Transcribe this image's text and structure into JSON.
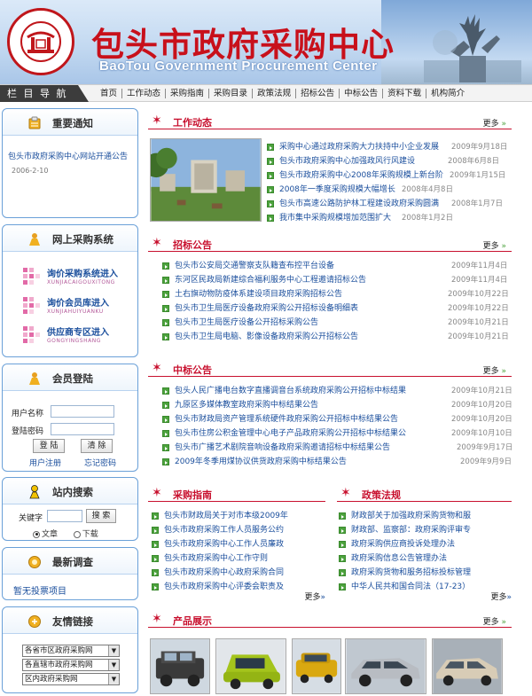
{
  "header": {
    "title": "包头市政府采购中心",
    "subtitle": "BaoTou Government Procurement Center",
    "logo_ring_text": "BaoTou Government Procurement Center",
    "logo_ring_text_cn": "包头市政府采购中心"
  },
  "nav": {
    "label": "栏 目 导 航",
    "items": [
      "首页",
      "工作动态",
      "采购指南",
      "采购目录",
      "政策法规",
      "招标公告",
      "中标公告",
      "资料下载",
      "机构简介"
    ]
  },
  "sidebar": {
    "notice": {
      "title": "重要通知",
      "text": "包头市政府采购中心网站开通公告",
      "date": "2006-2-10"
    },
    "online_purchase": {
      "title": "网上采购系统",
      "items": [
        {
          "name": "询价采购系统进入",
          "pinyin": "XUNJIACAIGOUXITONG"
        },
        {
          "name": "询价会员库进入",
          "pinyin": "XUNJIAHUIYUANKU"
        },
        {
          "name": "供应商专区进入",
          "pinyin": "GONGYINGSHANG"
        }
      ]
    },
    "login": {
      "title": "会员登陆",
      "username_label": "用户名称",
      "password_label": "登陆密码",
      "login_button": "登 陆",
      "clear_button": "清 除",
      "register_link": "用户注册",
      "forgot_link": "忘记密码"
    },
    "search": {
      "title": "站内搜索",
      "keyword_label": "关键字",
      "search_button": "搜 索",
      "option_article": "文章",
      "option_download": "下载"
    },
    "survey": {
      "title": "最新调查",
      "text": "暂无投票项目"
    },
    "links": {
      "title": "友情链接",
      "selects": [
        "各省市区政府采购网",
        "各直辖市政府采购网",
        "区内政府采购网"
      ]
    }
  },
  "main": {
    "more_label": "更多",
    "work_news": {
      "title": "工作动态",
      "items": [
        {
          "text": "采购中心通过政府采购大力扶持中小企业发展",
          "date": "2009年9月18日"
        },
        {
          "text": "包头市政府采购中心加强政风行风建设",
          "date": "2008年6月8日"
        },
        {
          "text": "包头市政府采购中心2008年采购规模上新台阶",
          "date": "2009年1月15日"
        },
        {
          "text": "2008年一季度采购规模大幅增长",
          "date": "2008年4月8日"
        },
        {
          "text": "包头市高速公路防护林工程建设政府采购圆满",
          "date": "2008年1月7日"
        },
        {
          "text": "我市集中采购规模增加范围扩大",
          "date": "2008年1月2日"
        }
      ]
    },
    "tender": {
      "title": "招标公告",
      "items": [
        {
          "text": "包头市公安局交通警察支队籍查布控平台设备",
          "date": "2009年11月4日"
        },
        {
          "text": "东河区民政局新建综合福利服务中心工程邀请招标公告",
          "date": "2009年11月4日"
        },
        {
          "text": "土右旗动物防疫体系建设项目政府采购招标公告",
          "date": "2009年10月22日"
        },
        {
          "text": "包头市卫生局医疗设备政府采购公开招标设备明细表",
          "date": "2009年10月22日"
        },
        {
          "text": "包头市卫生局医疗设备公开招标采购公告",
          "date": "2009年10月21日"
        },
        {
          "text": "包头市卫生局电脑、影像设备政府采购公开招标公告",
          "date": "2009年10月21日"
        }
      ]
    },
    "award": {
      "title": "中标公告",
      "items": [
        {
          "text": "包头人民广播电台数字直播调音台系统政府采购公开招标中标结果",
          "date": "2009年10月21日"
        },
        {
          "text": "九原区多媒体教室政府采购中标结果公告",
          "date": "2009年10月20日"
        },
        {
          "text": "包头市财政局资产管理系统硬件政府采购公开招标中标结果公告",
          "date": "2009年10月20日"
        },
        {
          "text": "包头市住房公积金管理中心电子产品政府采购公开招标中标结果公",
          "date": "2009年10月10日"
        },
        {
          "text": "包头市广播艺术剧院音响设备政府采购邀请招标中标结果公告",
          "date": "2009年9月17日"
        },
        {
          "text": "2009年冬季用煤协议供货政府采购中标结果公告",
          "date": "2009年9月9日"
        }
      ]
    },
    "guide": {
      "title": "采购指南",
      "items": [
        "包头市财政局关于对市本级2009年",
        "包头市政府采购工作人员服务公约",
        "包头市政府采购中心工作人员廉政",
        "包头市政府采购中心工作守则",
        "包头市政府采购中心政府采购合同",
        "包头市政府采购中心评委会职责及"
      ]
    },
    "policy": {
      "title": "政策法规",
      "items": [
        "财政部关于加强政府采购货物和服",
        "财政部、监察部：政府采购评审专",
        "政府采购供应商投诉处理办法",
        "政府采购信息公告管理办法",
        "政府采购货物和服务招标投标管理",
        "中华人民共和国合同法（17-23）"
      ]
    },
    "products": {
      "title": "产品展示"
    }
  },
  "colors": {
    "brand_red": "#c8102e",
    "link_blue": "#1a4e9c",
    "bullet_green": "#4ca23d",
    "sidebar_border": "#6aa0d8"
  }
}
